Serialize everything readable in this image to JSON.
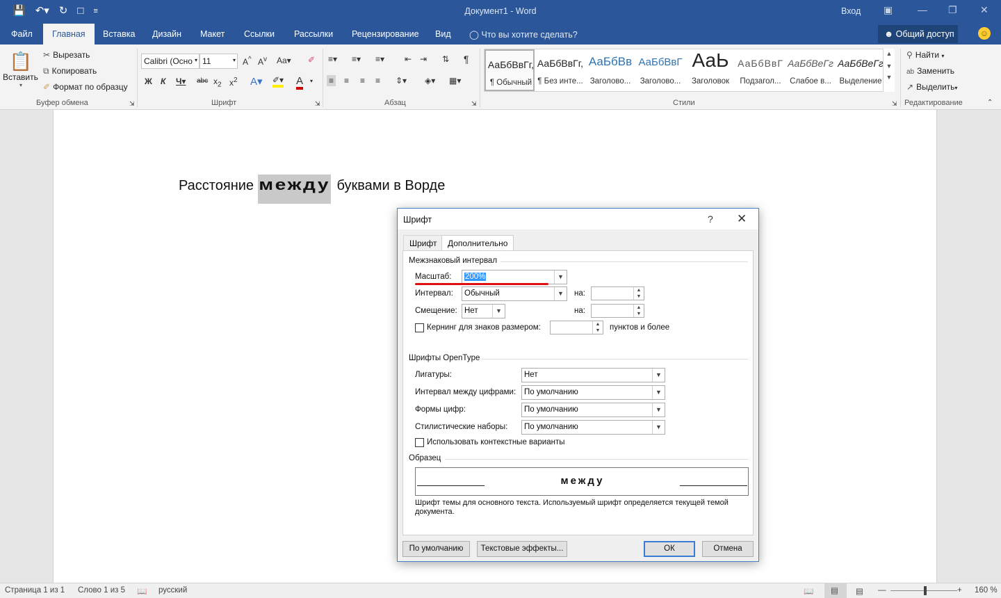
{
  "window": {
    "title": "Документ1  -  Word",
    "signin": "Вход"
  },
  "tabs": [
    "Файл",
    "Главная",
    "Вставка",
    "Дизайн",
    "Макет",
    "Ссылки",
    "Рассылки",
    "Рецензирование",
    "Вид"
  ],
  "tellme": "Что вы хотите сделать?",
  "share": "Общий доступ",
  "clipboard": {
    "paste": "Вставить",
    "cut": "Вырезать",
    "copy": "Копировать",
    "format_painter": "Формат по образцу",
    "label": "Буфер обмена"
  },
  "font_group": {
    "font_name": "Calibri (Осно",
    "font_size": "11",
    "label": "Шрифт"
  },
  "paragraph_group": {
    "label": "Абзац"
  },
  "styles_group": {
    "label": "Стили",
    "items": [
      {
        "preview": "АаБбВвГг,",
        "name": "¶ Обычный"
      },
      {
        "preview": "АаБбВвГг,",
        "name": "¶ Без инте..."
      },
      {
        "preview": "АаБбВв",
        "name": "Заголово..."
      },
      {
        "preview": "АаБбВвГ",
        "name": "Заголово..."
      },
      {
        "preview": "АаЬ",
        "name": "Заголовок"
      },
      {
        "preview": "АаБбВвГ",
        "name": "Подзагол..."
      },
      {
        "preview": "АаБбВеГг",
        "name": "Слабое в..."
      },
      {
        "preview": "АаБбВеГг",
        "name": "Выделение"
      }
    ]
  },
  "editing_group": {
    "find": "Найти",
    "replace": "Заменить",
    "select": "Выделить",
    "label": "Редактирование"
  },
  "document": {
    "before": "Расстояние",
    "highlight": "между",
    "after": "буквами в Ворде"
  },
  "status": {
    "page": "Страница 1 из 1",
    "words": "Слово 1 из 5",
    "language": "русский",
    "zoom": "160 %"
  },
  "dialog": {
    "title": "Шрифт",
    "help": "?",
    "tab_font": "Шрифт",
    "tab_advanced": "Дополнительно",
    "spacing_section": "Межзнаковый интервал",
    "scale_label": "Масштаб:",
    "scale_value": "200%",
    "spacing_label": "Интервал:",
    "spacing_value": "Обычный",
    "position_label": "Смещение:",
    "position_value": "Нет",
    "by_label": "на:",
    "kerning_label": "Кернинг для знаков размером:",
    "kerning_suffix": "пунктов и более",
    "opentype_section": "Шрифты OpenType",
    "ligatures_label": "Лигатуры:",
    "ligatures_value": "Нет",
    "num_spacing_label": "Интервал между цифрами:",
    "num_spacing_value": "По умолчанию",
    "num_forms_label": "Формы цифр:",
    "num_forms_value": "По умолчанию",
    "stylistic_label": "Стилистические наборы:",
    "stylistic_value": "По умолчанию",
    "contextual_label": "Использовать контекстные варианты",
    "preview_section": "Образец",
    "preview_word": "между",
    "description": "Шрифт темы для основного текста. Используемый шрифт определяется текущей темой документа.",
    "btn_default": "По умолчанию",
    "btn_effects": "Текстовые эффекты...",
    "btn_ok": "ОК",
    "btn_cancel": "Отмена"
  }
}
